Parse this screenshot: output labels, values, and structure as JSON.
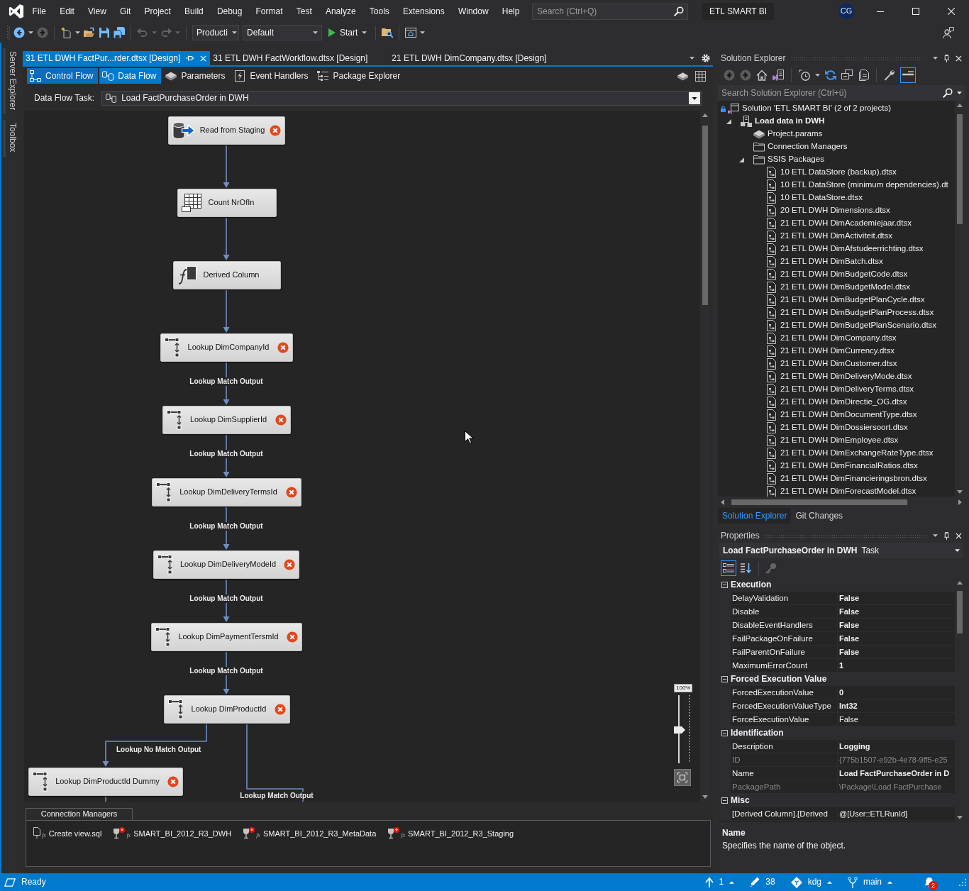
{
  "title_bar": {
    "menu": [
      "File",
      "Edit",
      "View",
      "Git",
      "Project",
      "Build",
      "Debug",
      "Format",
      "Test",
      "Analyze",
      "Tools",
      "Extensions",
      "Window",
      "Help"
    ],
    "search": {
      "placeholder": "Search (Ctrl+Q)"
    },
    "solution_title": "ETL SMART BI",
    "account_initials": "CG"
  },
  "toolbar": {
    "buttons": [
      {
        "kind": "back",
        "disabled": false
      },
      {
        "kind": "forward",
        "disabled": true
      },
      {
        "kind": "separator"
      },
      {
        "kind": "new_project",
        "disabled": false
      },
      {
        "kind": "open",
        "disabled": false
      },
      {
        "kind": "save",
        "disabled": false
      },
      {
        "kind": "save_all",
        "disabled": false
      },
      {
        "kind": "separator"
      },
      {
        "kind": "undo",
        "disabled": true
      },
      {
        "kind": "redo",
        "disabled": true
      },
      {
        "kind": "separator"
      }
    ],
    "configuration": "Producti",
    "platform": "Default",
    "start": "Start",
    "extra_buttons": [
      {
        "kind": "find_in_folder",
        "disabled": false
      },
      {
        "kind": "separator"
      },
      {
        "kind": "browser",
        "disabled": false
      }
    ]
  },
  "side_tabs": [
    "Server Explorer",
    "Toolbox"
  ],
  "document_tabs": [
    {
      "label": "31 ETL DWH FactPur...rder.dtsx [Design]",
      "selected": true
    },
    {
      "label": "31 ETL DWH FactWorkflow.dtsx [Design]",
      "selected": false
    },
    {
      "label": "21 ETL DWH DimCompany.dtsx [Design]",
      "selected": false
    }
  ],
  "designer_tabs": [
    {
      "kind": "control_flow",
      "label": "Control Flow",
      "selected": false,
      "hovered": true
    },
    {
      "kind": "data_flow",
      "label": "Data Flow",
      "selected": true,
      "hovered": false
    },
    {
      "kind": "parameters",
      "label": "Parameters",
      "selected": false,
      "hovered": false
    },
    {
      "kind": "event_handlers",
      "label": "Event Handlers",
      "selected": false,
      "hovered": false
    },
    {
      "kind": "package_explorer",
      "label": "Package Explorer",
      "selected": false,
      "hovered": false
    }
  ],
  "task_selector": {
    "label": "Data Flow Task:",
    "value": "Load FactPurchaseOrder in DWH"
  },
  "data_flow": {
    "nodes": [
      {
        "kind": "source",
        "label": "Read from Staging",
        "error": true
      },
      {
        "kind": "row_count",
        "label": "Count NrOfIn",
        "error": false
      },
      {
        "kind": "derived_column",
        "label": "Derived Column",
        "error": false
      },
      {
        "kind": "lookup",
        "label": "Lookup DimCompanyId",
        "error": true
      },
      {
        "kind": "lookup",
        "label": "Lookup DimSupplierId",
        "error": true
      },
      {
        "kind": "lookup",
        "label": "Lookup DimDeliveryTermsId",
        "error": true
      },
      {
        "kind": "lookup",
        "label": "Lookup DimDeliveryModeId",
        "error": true
      },
      {
        "kind": "lookup",
        "label": "Lookup DimPaymentTersmId",
        "error": true
      },
      {
        "kind": "lookup",
        "label": "Lookup DimProductId",
        "error": true
      },
      {
        "kind": "lookup",
        "label": "Lookup DimProductId Dummy",
        "error": true
      }
    ],
    "paths": [
      {
        "kind": "arrow"
      },
      {
        "kind": "arrow"
      },
      {
        "kind": "arrow"
      },
      {
        "kind": "arrow",
        "label": "Lookup Match Output"
      },
      {
        "kind": "arrow",
        "label": "Lookup Match Output"
      },
      {
        "kind": "arrow",
        "label": "Lookup Match Output"
      },
      {
        "kind": "arrow",
        "label": "Lookup Match Output"
      },
      {
        "kind": "arrow",
        "label": "Lookup Match Output"
      },
      {
        "kind": "arrow",
        "label": "Lookup No Match Output"
      },
      {
        "kind": "line",
        "label": "Lookup Match Output"
      },
      {
        "kind": "line"
      }
    ],
    "zoom": {
      "reading": "100%",
      "level": 0.5
    }
  },
  "connection_managers": {
    "title": "Connection Managers",
    "items": [
      {
        "kind": "file",
        "label": "Create view.sql",
        "error": false,
        "expression": "fx"
      },
      {
        "kind": "database",
        "label": "SMART_BI_2012_R3_DWH",
        "error": true,
        "expression": "fx"
      },
      {
        "kind": "database",
        "label": "SMART_BI_2012_R3_MetaData",
        "error": true,
        "expression": "fx"
      },
      {
        "kind": "database",
        "label": "SMART_BI_2012_R3_Staging",
        "error": true,
        "expression": "fx"
      }
    ]
  },
  "solution_explorer": {
    "title": "Solution Explorer",
    "toolbar": [
      {
        "kind": "back",
        "disabled": true,
        "on": false
      },
      {
        "kind": "forward",
        "disabled": true,
        "on": false
      },
      {
        "kind": "home",
        "disabled": false,
        "on": false
      },
      {
        "kind": "switch_views",
        "disabled": false,
        "on": false
      },
      {
        "kind": "separator"
      },
      {
        "kind": "pending_changes",
        "disabled": false,
        "on": false
      },
      {
        "kind": "sync",
        "disabled": false,
        "on": false
      },
      {
        "kind": "collapse_all",
        "disabled": false,
        "on": false
      },
      {
        "kind": "show_all_files",
        "disabled": false,
        "on": false
      },
      {
        "kind": "separator"
      },
      {
        "kind": "properties",
        "disabled": false,
        "on": false
      },
      {
        "kind": "preview",
        "disabled": false,
        "on": true
      }
    ],
    "search": {
      "placeholder": "Search Solution Explorer (Ctrl+ü)"
    },
    "tree": [
      {
        "kind": "solution",
        "label": "Solution 'ETL SMART BI' (2 of 2 projects)",
        "children": [
          {
            "kind": "project",
            "label": "Load data in DWH",
            "expanded": true,
            "startup": true,
            "children": [
              {
                "kind": "params",
                "label": "Project.params"
              },
              {
                "kind": "folder",
                "label": "Connection Managers"
              },
              {
                "kind": "folder",
                "label": "SSIS Packages",
                "expanded": true,
                "children": [
                  {
                    "kind": "package",
                    "label": "10 ETL DataStore (backup).dtsx"
                  },
                  {
                    "kind": "package",
                    "label": "10 ETL DataStore (minimum dependencies).dt"
                  },
                  {
                    "kind": "package",
                    "label": "10 ETL DataStore.dtsx"
                  },
                  {
                    "kind": "package",
                    "label": "20 ETL DWH Dimensions.dtsx"
                  },
                  {
                    "kind": "package",
                    "label": "21 ETL DWH DimAcademiejaar.dtsx"
                  },
                  {
                    "kind": "package",
                    "label": "21 ETL DWH DimActiviteit.dtsx"
                  },
                  {
                    "kind": "package",
                    "label": "21 ETL DWH DimAfstudeerrichting.dtsx"
                  },
                  {
                    "kind": "package",
                    "label": "21 ETL DWH DimBatch.dtsx"
                  },
                  {
                    "kind": "package",
                    "label": "21 ETL DWH DimBudgetCode.dtsx"
                  },
                  {
                    "kind": "package",
                    "label": "21 ETL DWH DimBudgetModel.dtsx"
                  },
                  {
                    "kind": "package",
                    "label": "21 ETL DWH DimBudgetPlanCycle.dtsx"
                  },
                  {
                    "kind": "package",
                    "label": "21 ETL DWH DimBudgetPlanProcess.dtsx"
                  },
                  {
                    "kind": "package",
                    "label": "21 ETL DWH DimBudgetPlanScenario.dtsx"
                  },
                  {
                    "kind": "package",
                    "label": "21 ETL DWH DimCompany.dtsx"
                  },
                  {
                    "kind": "package",
                    "label": "21 ETL DWH DimCurrency.dtsx"
                  },
                  {
                    "kind": "package",
                    "label": "21 ETL DWH DimCustomer.dtsx"
                  },
                  {
                    "kind": "package",
                    "label": "21 ETL DWH DimDeliveryMode.dtsx"
                  },
                  {
                    "kind": "package",
                    "label": "21 ETL DWH DimDeliveryTerms.dtsx"
                  },
                  {
                    "kind": "package",
                    "label": "21 ETL DWH DimDirectie_OG.dtsx"
                  },
                  {
                    "kind": "package",
                    "label": "21 ETL DWH DimDocumentType.dtsx"
                  },
                  {
                    "kind": "package",
                    "label": "21 ETL DWH DimDossiersoort.dtsx"
                  },
                  {
                    "kind": "package",
                    "label": "21 ETL DWH DimEmployee.dtsx"
                  },
                  {
                    "kind": "package",
                    "label": "21 ETL DWH DimExchangeRateType.dtsx"
                  },
                  {
                    "kind": "package",
                    "label": "21 ETL DWH DimFinancialRatios.dtsx"
                  },
                  {
                    "kind": "package",
                    "label": "21 ETL DWH DimFinancieringsbron.dtsx"
                  },
                  {
                    "kind": "package",
                    "label": "21 ETL DWH DimForecastModel.dtsx"
                  }
                ]
              }
            ]
          }
        ]
      }
    ],
    "tabs": [
      {
        "label": "Solution Explorer",
        "selected": true
      },
      {
        "label": "Git Changes",
        "selected": false
      }
    ]
  },
  "properties": {
    "title": "Properties",
    "object_name": "Load FactPurchaseOrder in DWH",
    "object_type": "Task",
    "view_buttons": [
      {
        "kind": "categorized",
        "selected": true
      },
      {
        "kind": "alphabetical",
        "selected": false
      }
    ],
    "property_pages_button": {
      "disabled": true
    },
    "categories": [
      {
        "name": "Execution",
        "expanded": true,
        "rows": [
          {
            "name": "DelayValidation",
            "value": "False",
            "modified": true,
            "readonly": false
          },
          {
            "name": "Disable",
            "value": "False",
            "modified": true,
            "readonly": false
          },
          {
            "name": "DisableEventHandlers",
            "value": "False",
            "modified": true,
            "readonly": false
          },
          {
            "name": "FailPackageOnFailure",
            "value": "False",
            "modified": true,
            "readonly": false
          },
          {
            "name": "FailParentOnFailure",
            "value": "False",
            "modified": true,
            "readonly": false
          },
          {
            "name": "MaximumErrorCount",
            "value": "1",
            "modified": true,
            "readonly": false
          }
        ]
      },
      {
        "name": "Forced Execution Value",
        "expanded": true,
        "rows": [
          {
            "name": "ForcedExecutionValue",
            "value": "0",
            "modified": true,
            "readonly": false
          },
          {
            "name": "ForcedExecutionValueType",
            "value": "Int32",
            "modified": true,
            "readonly": false
          },
          {
            "name": "ForceExecutionValue",
            "value": "False",
            "modified": false,
            "readonly": false
          }
        ]
      },
      {
        "name": "Identification",
        "expanded": true,
        "rows": [
          {
            "name": "Description",
            "value": "Logging",
            "modified": true,
            "readonly": false
          },
          {
            "name": "ID",
            "value": "{775b1507-e92b-4e78-9ff5-e25",
            "modified": false,
            "readonly": true
          },
          {
            "name": "Name",
            "value": "Load FactPurchaseOrder in D",
            "modified": true,
            "readonly": false
          },
          {
            "name": "PackagePath",
            "value": "\\Package\\Load FactPurchase",
            "modified": false,
            "readonly": true
          }
        ]
      },
      {
        "name": "Misc",
        "expanded": true,
        "rows": [
          {
            "name": "[Derived Column].[Derived",
            "value": "@[User::ETLRunId]",
            "modified": false,
            "readonly": false
          }
        ]
      }
    ],
    "description": {
      "title": "Name",
      "text": "Specifies the name of the object."
    }
  },
  "status_bar": {
    "message": "Ready",
    "items": [
      {
        "kind": "push",
        "label": "1",
        "menu": true
      },
      {
        "kind": "changes",
        "label": "38",
        "menu": false
      },
      {
        "kind": "repository",
        "label": "kdg",
        "menu": true
      },
      {
        "kind": "branch",
        "label": "main",
        "menu": true
      }
    ],
    "notifications": "2"
  }
}
